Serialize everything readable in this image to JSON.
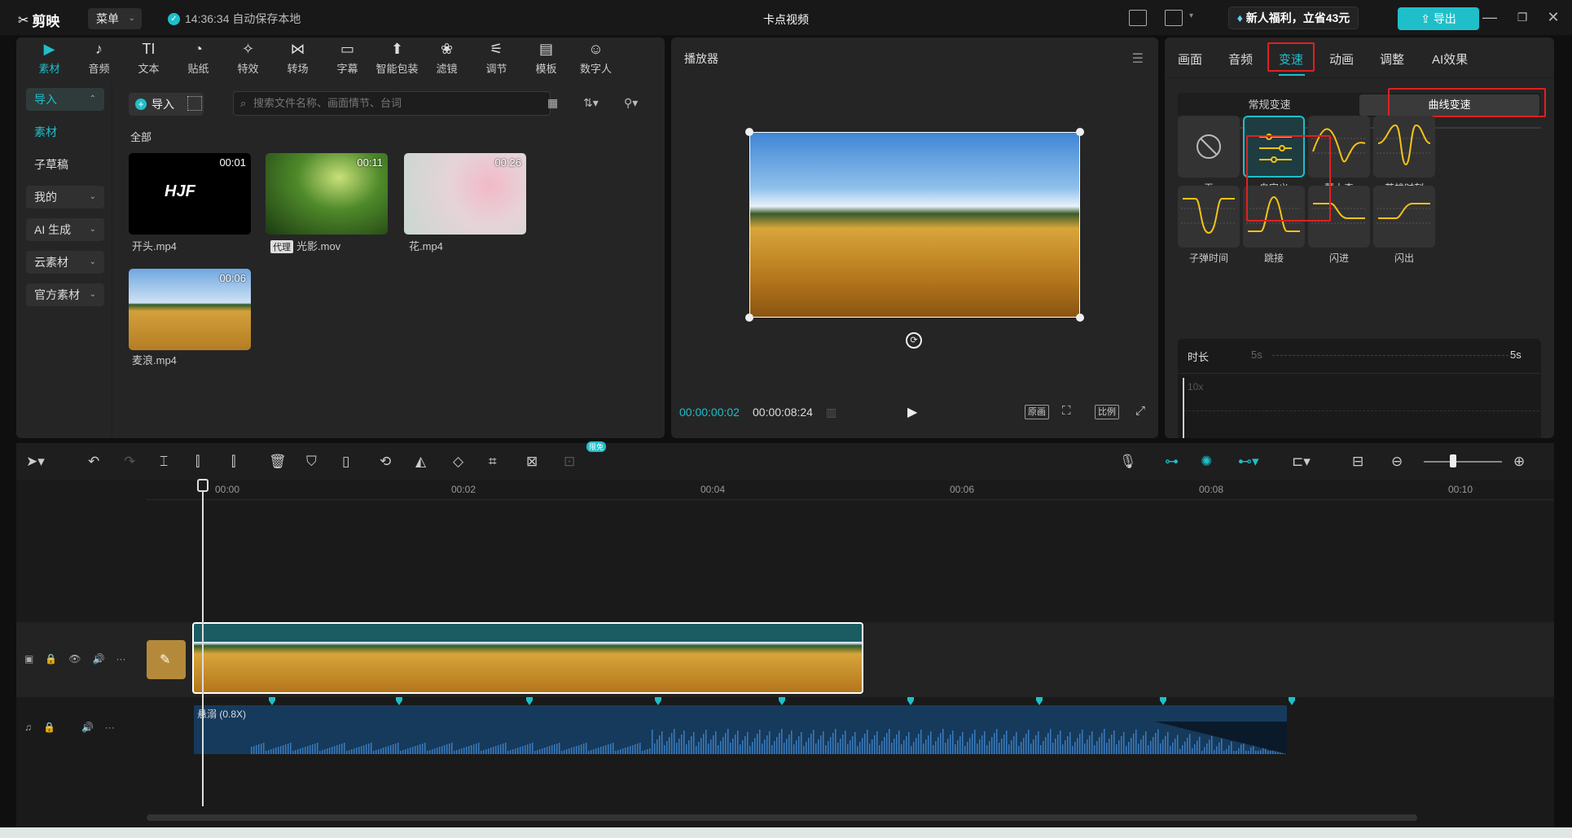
{
  "titlebar": {
    "app_name": "剪映",
    "menu_label": "菜单",
    "save_status": "14:36:34 自动保存本地",
    "project_title": "卡点视频",
    "promo": "新人福利，立省43元",
    "export_label": "导出"
  },
  "media_toolbar": [
    {
      "label": "素材",
      "icon": "▶"
    },
    {
      "label": "音频",
      "icon": "♪"
    },
    {
      "label": "文本",
      "icon": "TI"
    },
    {
      "label": "贴纸",
      "icon": "◔"
    },
    {
      "label": "特效",
      "icon": "✧"
    },
    {
      "label": "转场",
      "icon": "⋈"
    },
    {
      "label": "字幕",
      "icon": "▭"
    },
    {
      "label": "智能包装",
      "icon": "⬆"
    },
    {
      "label": "滤镜",
      "icon": "❀"
    },
    {
      "label": "调节",
      "icon": "⚟"
    },
    {
      "label": "模板",
      "icon": "▤"
    },
    {
      "label": "数字人",
      "icon": "☺"
    }
  ],
  "sidebar": {
    "items": [
      {
        "label": "导入"
      },
      {
        "label": "素材"
      },
      {
        "label": "子草稿"
      },
      {
        "label": "我的"
      },
      {
        "label": "AI 生成"
      },
      {
        "label": "云素材"
      },
      {
        "label": "官方素材"
      }
    ]
  },
  "media": {
    "import_label": "导入",
    "search_placeholder": "搜索文件名称、画面情节、台词",
    "all_label": "全部",
    "items": [
      {
        "name": "开头.mp4",
        "duration": "00:01"
      },
      {
        "name": "光影.mov",
        "duration": "00:11",
        "proxy": "代理"
      },
      {
        "name": "花.mp4",
        "duration": "00:26"
      },
      {
        "name": "麦浪.mp4",
        "duration": "00:06"
      }
    ],
    "thumb_text": "HJF"
  },
  "player": {
    "title": "播放器",
    "current_time": "00:00:00:02",
    "total_time": "00:00:08:24",
    "btn_original": "原画",
    "btn_ratio": "比例"
  },
  "props": {
    "tabs": [
      "画面",
      "音频",
      "变速",
      "动画",
      "调整",
      "AI效果"
    ],
    "active_tab": "变速",
    "speed_modes": [
      "常规变速",
      "曲线变速"
    ],
    "curves": [
      {
        "label": "无"
      },
      {
        "label": "自定义"
      },
      {
        "label": "蒙太奇"
      },
      {
        "label": "英雄时刻"
      },
      {
        "label": "子弹时间"
      },
      {
        "label": "跳接"
      },
      {
        "label": "闪进"
      },
      {
        "label": "闪出"
      }
    ],
    "duration_label": "时长",
    "duration_from": "5s",
    "duration_to": "5s",
    "graph_ymax": "10x"
  },
  "timeline": {
    "ruler": [
      "00:00",
      "00:02",
      "00:04",
      "00:06",
      "00:08",
      "00:10"
    ],
    "toolbar_badge": "限免",
    "audio_clip_label": "悬溺 (0.8X)"
  },
  "colors": {
    "accent": "#1fbfc9",
    "highlight_box": "#e02020",
    "curve_line": "#f2c318"
  }
}
